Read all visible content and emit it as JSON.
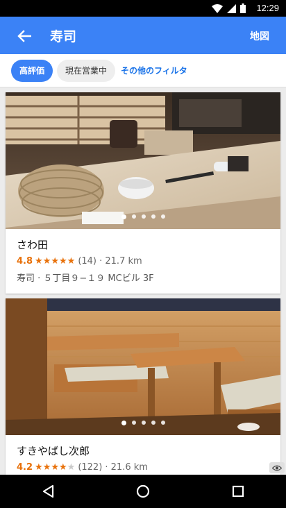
{
  "status": {
    "time": "12:29"
  },
  "appbar": {
    "title": "寿司",
    "map_label": "地図"
  },
  "filters": {
    "top_rated": "高評価",
    "open_now": "現在営業中",
    "more_filters": "その他のフィルタ"
  },
  "restaurants": [
    {
      "name": "さわ田",
      "rating": "4.8",
      "stars": 5,
      "reviews": "(14) · 21.7 km",
      "address": "寿司 · ５丁目９−１９ MCビル 3F"
    },
    {
      "name": "すきやばし次郎",
      "rating": "4.2",
      "stars": 4,
      "reviews": "(122) · 21.6 km",
      "address": ""
    }
  ],
  "photos": [
    {
      "description_icon": "sushi-counter-photo"
    },
    {
      "description_icon": "restaurant-booth-photo"
    }
  ],
  "colors": {
    "accent": "#3b82f6",
    "rating": "#e8710a"
  }
}
